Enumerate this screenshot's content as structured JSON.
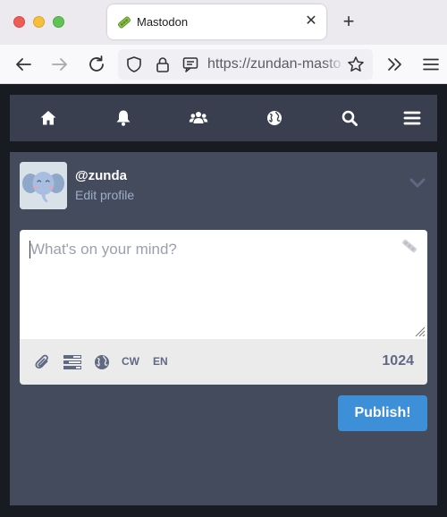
{
  "browser": {
    "tab_title": "Mastodon",
    "tab_close": "✕",
    "new_tab": "+",
    "url": "https://zundan-masto"
  },
  "app": {
    "nav_icons": [
      "home-icon",
      "bell-icon",
      "users-icon",
      "globe-icon",
      "search-icon",
      "bars-icon"
    ]
  },
  "compose": {
    "username": "@zunda",
    "edit_profile": "Edit profile",
    "placeholder": "What's on your mind?",
    "cw_label": "CW",
    "lang_label": "EN",
    "char_count": "1024",
    "publish_label": "Publish!"
  },
  "colors": {
    "accent": "#3d8fd7",
    "nav_bg": "#393f4f",
    "panel_bg": "#444b5d",
    "icon": "#606984"
  }
}
